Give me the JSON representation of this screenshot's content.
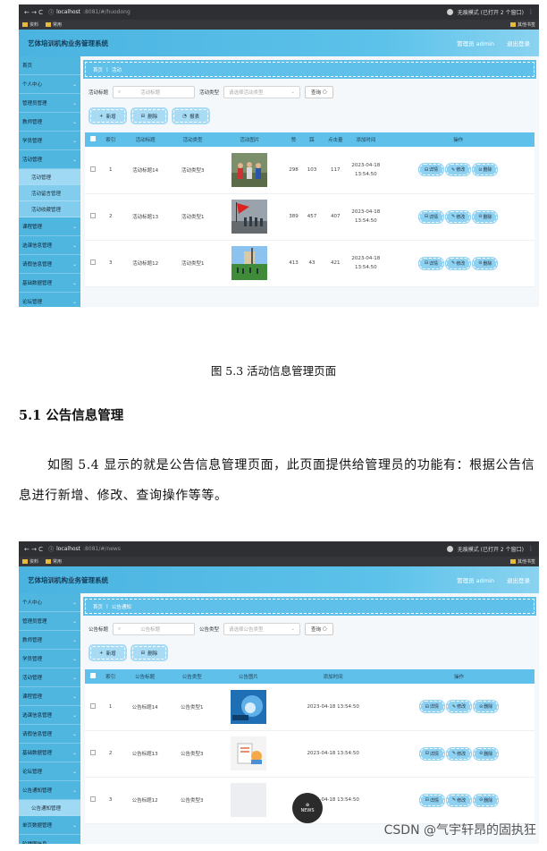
{
  "shot1": {
    "browser": {
      "url_host": "localhost",
      "url_path": ":8081/#/huodong",
      "mode": "无痕模式 (已打开 2 个窗口)",
      "bookmarks": [
        "资料",
        "常用"
      ],
      "other_bookmarks": "其他书签"
    },
    "app_title": "艺体培训机构业务管理系统",
    "admin": "管理员 admin",
    "logout": "退出登录",
    "sidebar": [
      {
        "label": "首页",
        "chevron": false
      },
      {
        "label": "个人中心",
        "chevron": true
      },
      {
        "label": "管理员管理",
        "chevron": true
      },
      {
        "label": "教师管理",
        "chevron": true
      },
      {
        "label": "学员管理",
        "chevron": true
      },
      {
        "label": "活动管理",
        "chevron": true
      },
      {
        "label": "活动管理",
        "sub": true,
        "on": true
      },
      {
        "label": "活动留言管理",
        "sub": true
      },
      {
        "label": "活动收藏管理",
        "sub": true
      },
      {
        "label": "课程管理",
        "chevron": true
      },
      {
        "label": "选课信息管理",
        "chevron": true
      },
      {
        "label": "请假信息管理",
        "chevron": true
      },
      {
        "label": "基础数据管理",
        "chevron": true
      },
      {
        "label": "论坛管理",
        "chevron": true
      }
    ],
    "breadcrumb": [
      "首页",
      "活动"
    ],
    "search": {
      "label1": "活动标题",
      "placeholder1": "活动标题",
      "label2": "活动类型",
      "placeholder2": "请选择活动类型",
      "query": "查询"
    },
    "actions": [
      "新增",
      "删除",
      "报表"
    ],
    "columns": [
      "索引",
      "活动标题",
      "活动类型",
      "活动图片",
      "赞",
      "踩",
      "点击量",
      "添加时间",
      "操作"
    ],
    "rows": [
      {
        "idx": "1",
        "title": "活动标题14",
        "type": "活动类型3",
        "zan": "298",
        "cai": "103",
        "clicks": "117",
        "time": "2023-04-18 13:54:50",
        "img": "people-photo"
      },
      {
        "idx": "2",
        "title": "活动标题13",
        "type": "活动类型1",
        "zan": "389",
        "cai": "457",
        "clicks": "407",
        "time": "2023-04-18 13:54:50",
        "img": "flag-photo"
      },
      {
        "idx": "3",
        "title": "活动标题12",
        "type": "活动类型1",
        "zan": "413",
        "cai": "43",
        "clicks": "421",
        "time": "2023-04-18 13:54:50",
        "img": "field-photo"
      }
    ],
    "ops": [
      "详情",
      "修改",
      "删除"
    ]
  },
  "caption": "图 5.3  活动信息管理页面",
  "heading": "5.1 公告信息管理",
  "paragraph": "如图 5.4 显示的就是公告信息管理页面，此页面提供给管理员的功能有：根据公告信息进行新增、修改、查询操作等等。",
  "shot2": {
    "browser": {
      "url_host": "localhost",
      "url_path": ":8081/#/news",
      "mode": "无痕模式 (已打开 2 个窗口)",
      "bookmarks": [
        "资料",
        "常用"
      ],
      "other_bookmarks": "其他书签"
    },
    "app_title": "艺体培训机构业务管理系统",
    "admin": "管理员 admin",
    "logout": "退出登录",
    "sidebar": [
      {
        "label": "个人中心",
        "chevron": true
      },
      {
        "label": "管理员管理",
        "chevron": true
      },
      {
        "label": "教师管理",
        "chevron": true
      },
      {
        "label": "学员管理",
        "chevron": true
      },
      {
        "label": "活动管理",
        "chevron": true
      },
      {
        "label": "课程管理",
        "chevron": true
      },
      {
        "label": "选课信息管理",
        "chevron": true
      },
      {
        "label": "请假信息管理",
        "chevron": true
      },
      {
        "label": "基础数据管理",
        "chevron": true
      },
      {
        "label": "论坛管理",
        "chevron": true
      },
      {
        "label": "公告通知管理",
        "chevron": true
      },
      {
        "label": "公告通知管理",
        "sub": true,
        "on": true
      },
      {
        "label": "单页数据管理",
        "chevron": true
      },
      {
        "label": "轮播图信息",
        "chevron": true
      }
    ],
    "breadcrumb": [
      "首页",
      "公告通知"
    ],
    "search": {
      "label1": "公告标题",
      "placeholder1": "公告标题",
      "label2": "公告类型",
      "placeholder2": "请选择公告类型",
      "query": "查询"
    },
    "actions": [
      "新增",
      "删除"
    ],
    "columns": [
      "索引",
      "公告标题",
      "公告类型",
      "公告图片",
      "添加时间",
      "操作"
    ],
    "rows": [
      {
        "idx": "1",
        "title": "公告标题14",
        "type": "公告类型1",
        "time": "2023-04-18 13:54:50",
        "img": "blue-abstract"
      },
      {
        "idx": "2",
        "title": "公告标题13",
        "type": "公告类型3",
        "time": "2023-04-18 13:54:50",
        "img": "document-illustration"
      },
      {
        "idx": "3",
        "title": "公告标题12",
        "type": "公告类型3",
        "time": "2023-04-18 13:54:50",
        "img": "news-icon"
      }
    ],
    "ops": [
      "详情",
      "修改",
      "删除"
    ]
  },
  "news_badge": "NEWS",
  "watermark": "CSDN @气宇轩昂的固执狂"
}
